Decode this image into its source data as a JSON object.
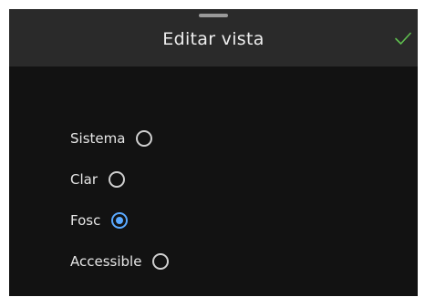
{
  "header": {
    "title": "Editar vista",
    "confirm_icon": "checkmark-icon",
    "confirm_color": "#5fbf4f"
  },
  "options": [
    {
      "label": "Sistema",
      "selected": false
    },
    {
      "label": "Clar",
      "selected": false
    },
    {
      "label": "Fosc",
      "selected": true
    },
    {
      "label": "Accessible",
      "selected": false
    }
  ],
  "colors": {
    "background": "#121212",
    "header": "#2a2a2a",
    "accent": "#5aa9ff"
  }
}
